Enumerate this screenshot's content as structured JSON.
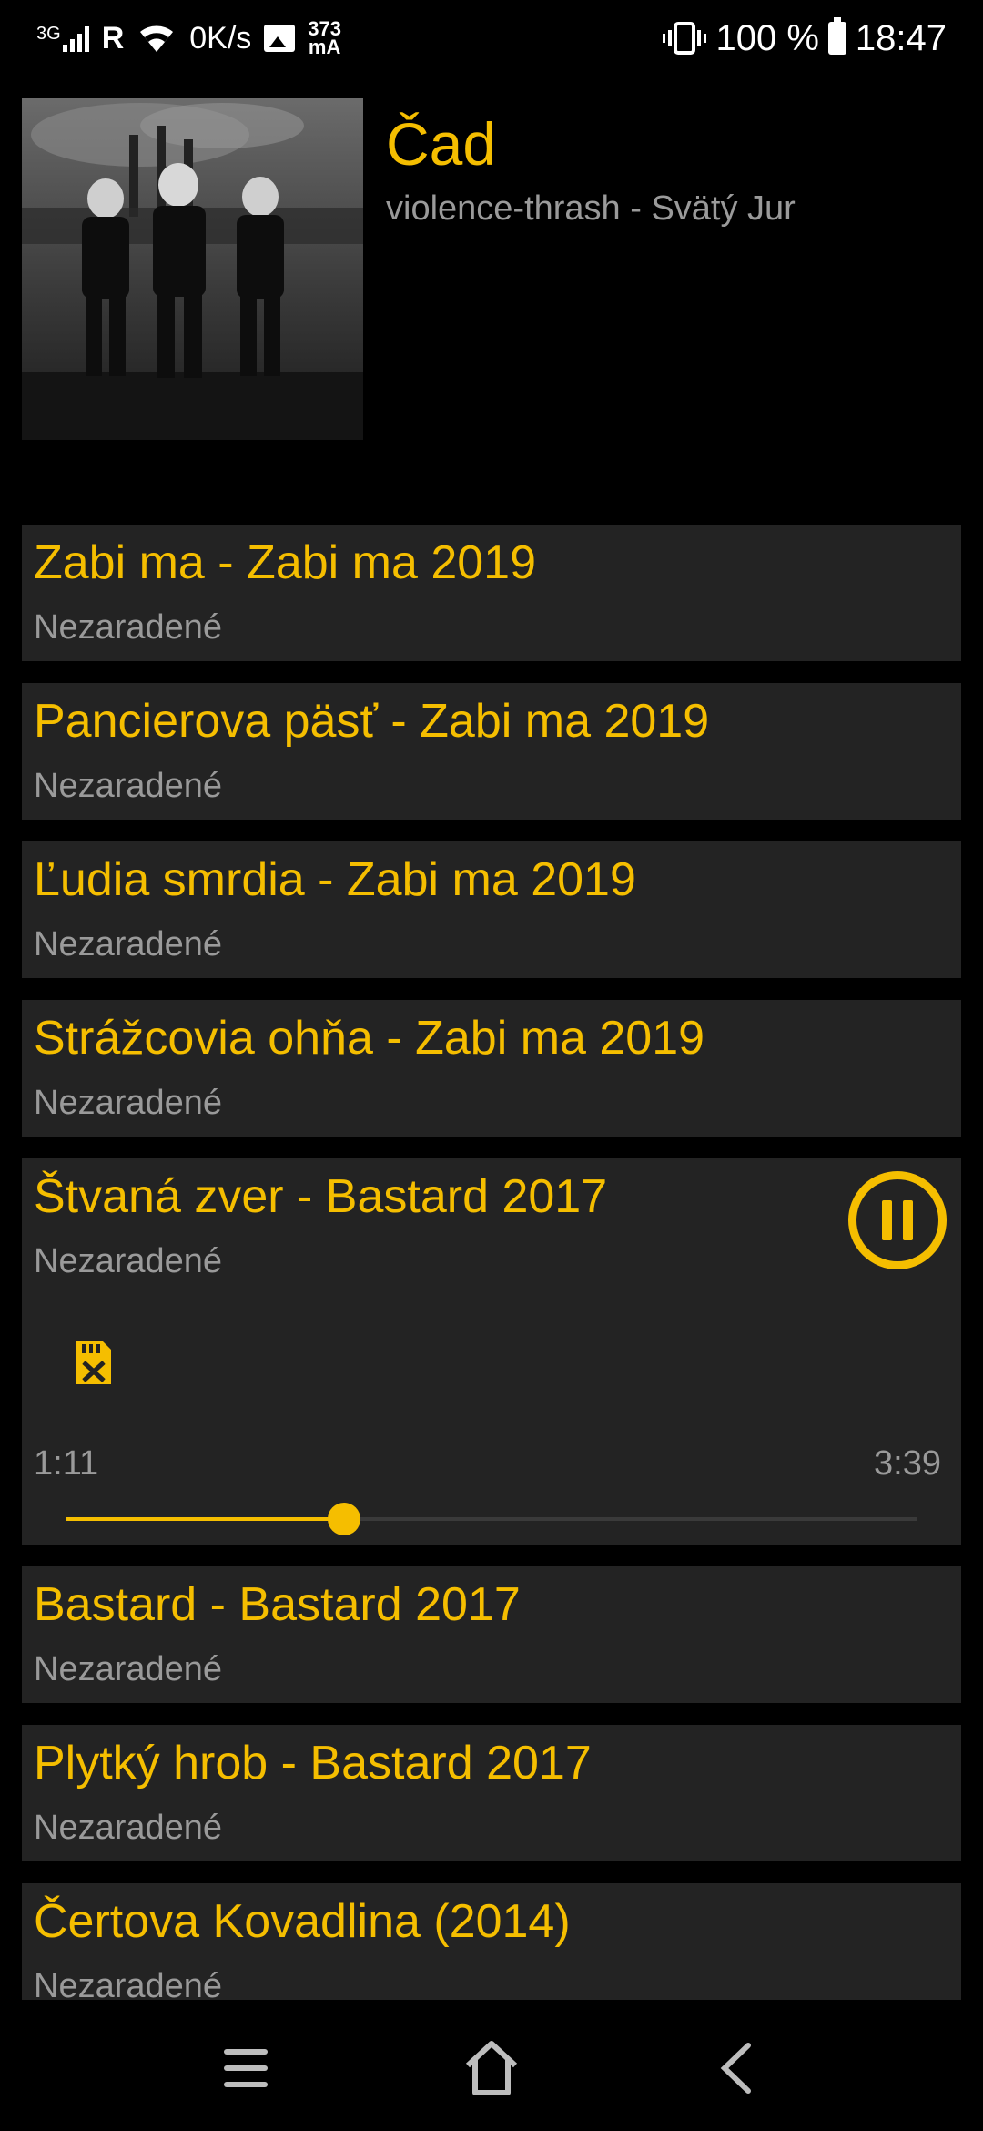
{
  "status_bar": {
    "network": "3G",
    "roaming": "R",
    "speed": "0K/s",
    "current": "373",
    "current_unit": "mA",
    "battery": "100 %",
    "time": "18:47",
    "icons": [
      "signal-icon",
      "wifi-icon",
      "image-icon",
      "vibrate-icon",
      "battery-icon"
    ]
  },
  "header": {
    "artist": "Čad",
    "subtitle": "violence-thrash - Svätý Jur"
  },
  "tracks": [
    {
      "title": "Zabi ma - Zabi ma 2019",
      "category": "Nezaradené"
    },
    {
      "title": "Pancierova päsť - Zabi ma 2019",
      "category": "Nezaradené"
    },
    {
      "title": "Ľudia smrdia - Zabi ma 2019",
      "category": "Nezaradené"
    },
    {
      "title": "Strážcovia ohňa - Zabi ma 2019",
      "category": "Nezaradené"
    },
    {
      "title": "Štvaná zver - Bastard 2017",
      "category": "Nezaradené"
    },
    {
      "title": "Bastard - Bastard 2017",
      "category": "Nezaradené"
    },
    {
      "title": "Plytký hrob - Bastard 2017",
      "category": "Nezaradené"
    },
    {
      "title": "Čertova Kovadlina (2014)",
      "category": "Nezaradené"
    }
  ],
  "player": {
    "current_time": "1:11",
    "total_time": "3:39",
    "progress": 0.327
  },
  "colors": {
    "accent": "#F5BE00",
    "item_bg": "#232323",
    "secondary_text": "#9a9a9a",
    "background": "#000000"
  }
}
